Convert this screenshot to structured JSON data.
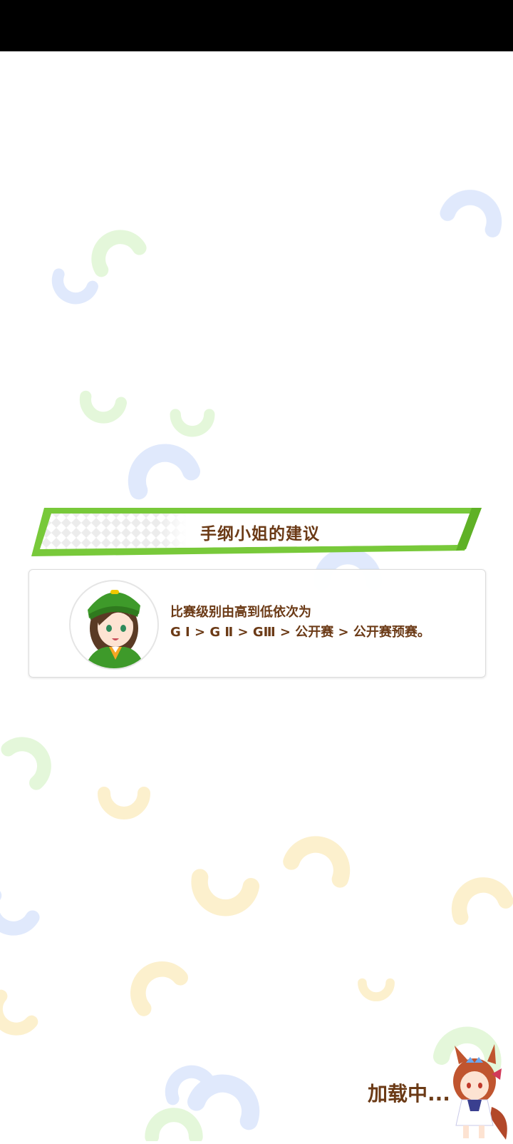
{
  "banner": {
    "title": "手纲小姐的建议"
  },
  "advice": {
    "line1": "比赛级别由高到低依次为",
    "line2": "G Ⅰ > G Ⅱ > GⅢ > 公开赛 > 公开赛预赛。"
  },
  "loading": {
    "label": "加载中..."
  },
  "colors": {
    "accent_green": "#78c93a",
    "text_brown": "#6b3a16",
    "status_bar": "#000000"
  },
  "icons": {
    "background": "horseshoe-icon",
    "avatar": "trainer-avatar",
    "mascot": "horse-girl-mascot"
  }
}
